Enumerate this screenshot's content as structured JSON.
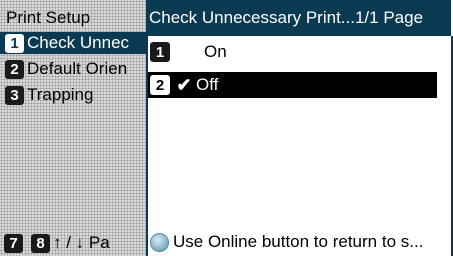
{
  "left": {
    "title": "Print Setup",
    "items": [
      {
        "num": "1",
        "label": "Check Unnec"
      },
      {
        "num": "2",
        "label": "Default Orien"
      },
      {
        "num": "3",
        "label": "Trapping"
      }
    ],
    "footer": {
      "keys": [
        "7",
        "8"
      ],
      "text": "↑ / ↓ Pa"
    }
  },
  "panel": {
    "title": "Check Unnecessary Print...1/1 Page",
    "options": [
      {
        "num": "1",
        "label": "On",
        "selected": false,
        "checked": false
      },
      {
        "num": "2",
        "label": "Off",
        "selected": true,
        "checked": true,
        "check_glyph": "✔"
      }
    ],
    "hint": "Use Online button to return to s..."
  },
  "colors": {
    "accent": "#0a3a52",
    "selected_row": "#000000",
    "dotted_bg": "#d8d8d8"
  }
}
